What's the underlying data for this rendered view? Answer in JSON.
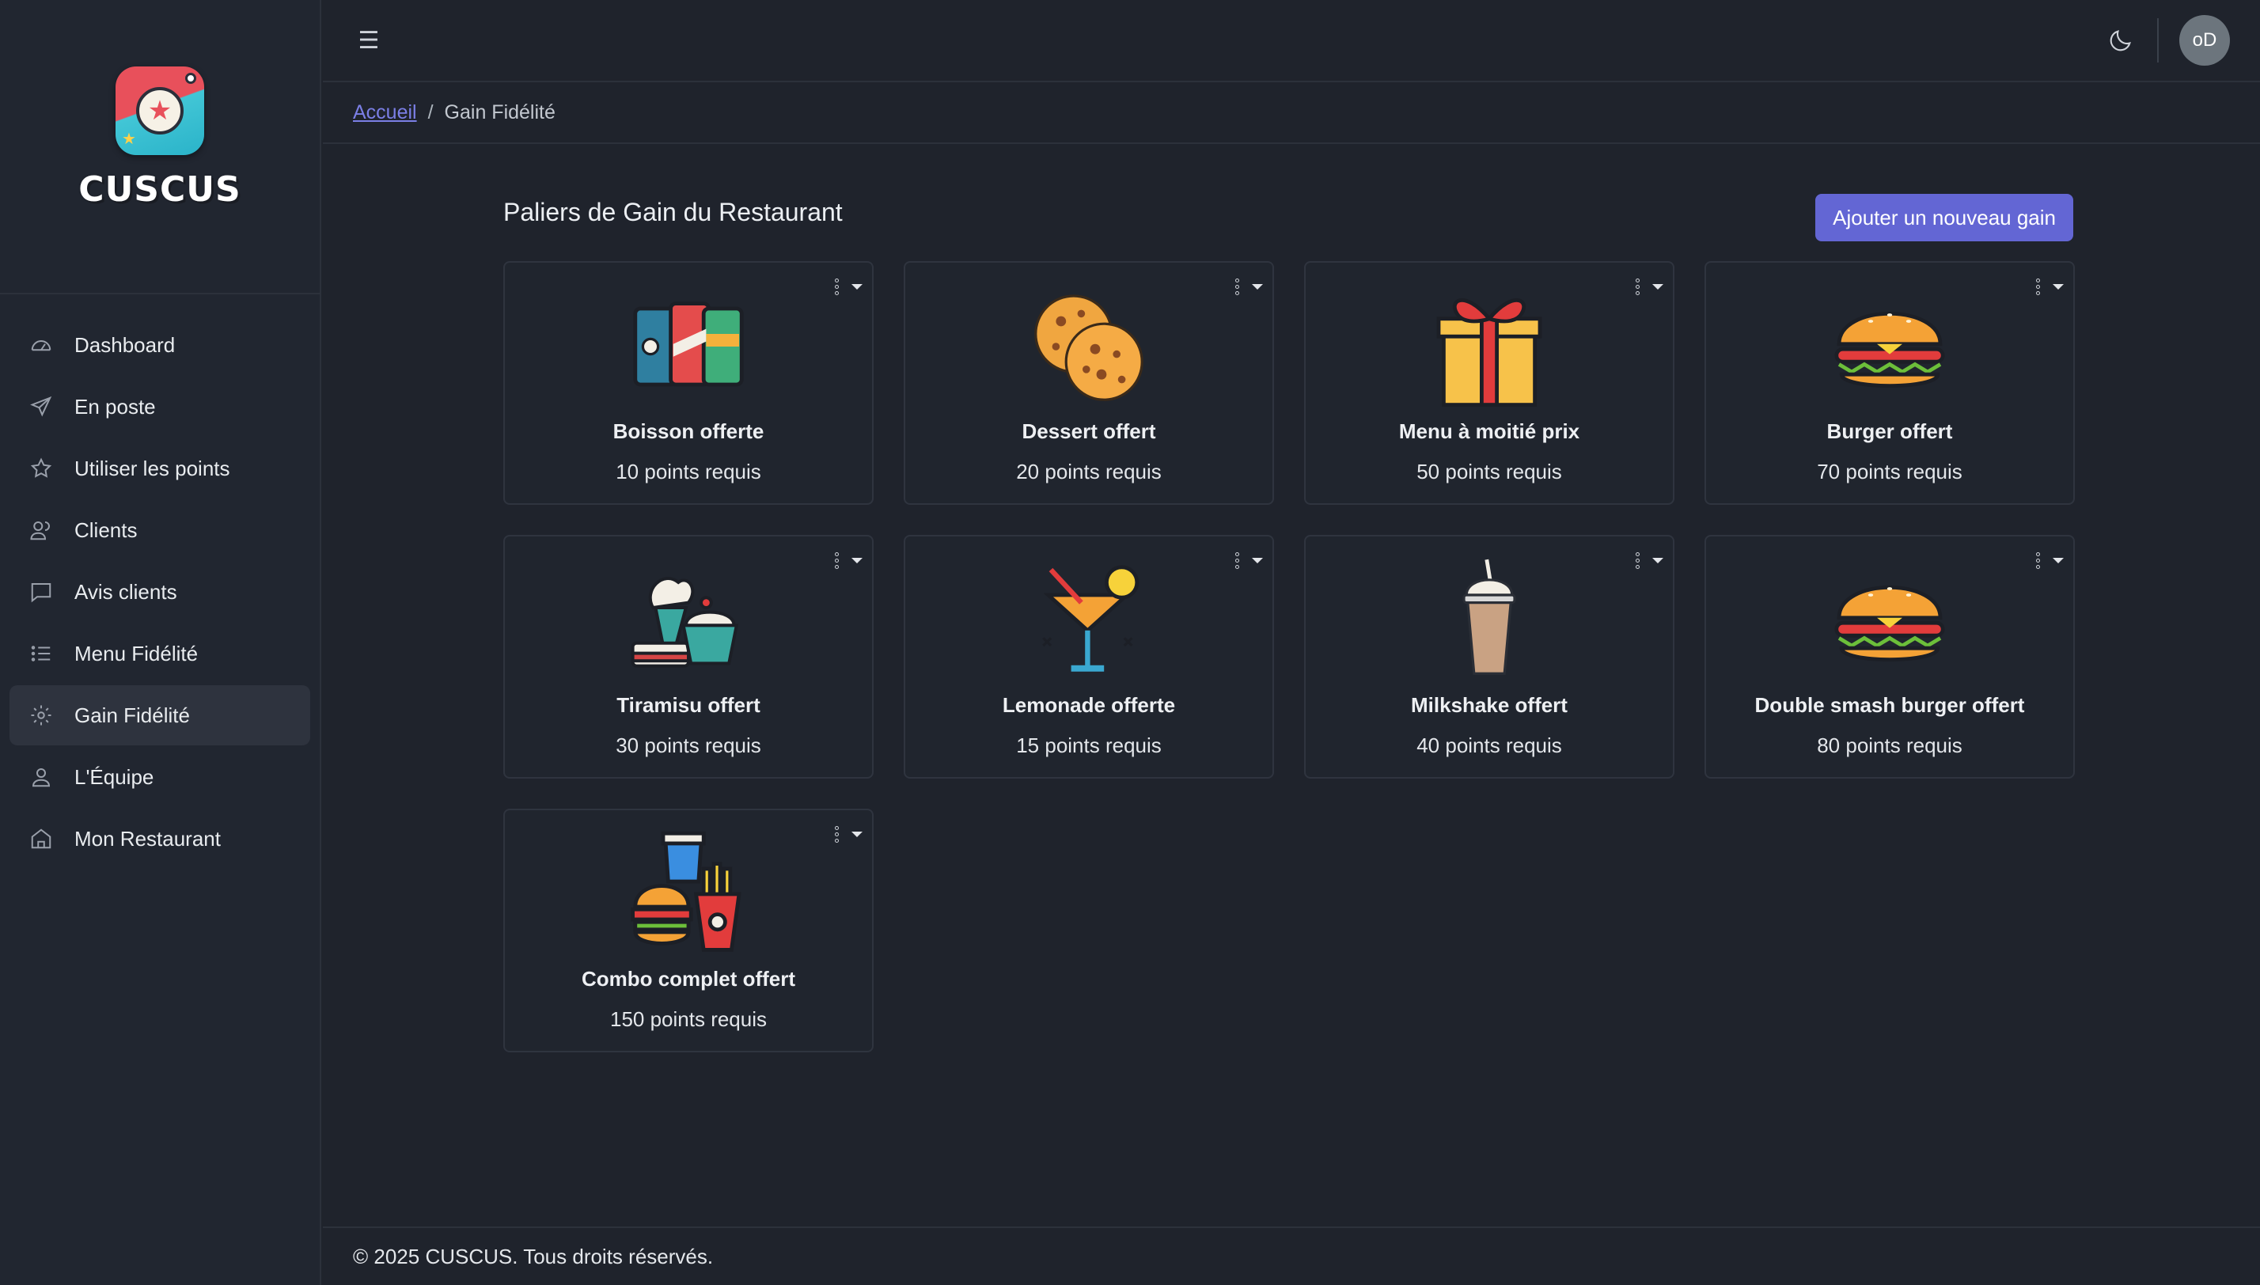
{
  "brand": {
    "name": "CUSCUS"
  },
  "sidebar": {
    "items": [
      {
        "label": "Dashboard",
        "icon": "gauge-icon"
      },
      {
        "label": "En poste",
        "icon": "send-icon"
      },
      {
        "label": "Utiliser les points",
        "icon": "star-icon"
      },
      {
        "label": "Clients",
        "icon": "users-icon"
      },
      {
        "label": "Avis clients",
        "icon": "chat-icon"
      },
      {
        "label": "Menu Fidélité",
        "icon": "list-icon"
      },
      {
        "label": "Gain Fidélité",
        "icon": "gear-icon",
        "active": true
      },
      {
        "label": "L'Équipe",
        "icon": "team-icon"
      },
      {
        "label": "Mon Restaurant",
        "icon": "store-icon"
      }
    ]
  },
  "topbar": {
    "avatar_initials": "oD",
    "menu_icon": "☰"
  },
  "breadcrumb": {
    "home": "Accueil",
    "separator": "/",
    "current": "Gain Fidélité"
  },
  "page": {
    "title": "Paliers de Gain du Restaurant",
    "add_button": "Ajouter un nouveau gain"
  },
  "rewards": [
    {
      "name": "Boisson offerte",
      "points": "10 points requis",
      "icon": "drinks-icon"
    },
    {
      "name": "Dessert offert",
      "points": "20 points requis",
      "icon": "cookies-icon"
    },
    {
      "name": "Menu à moitié prix",
      "points": "50 points requis",
      "icon": "gift-icon"
    },
    {
      "name": "Burger offert",
      "points": "70 points requis",
      "icon": "burger-icon"
    },
    {
      "name": "Tiramisu offert",
      "points": "30 points requis",
      "icon": "desserts-icon"
    },
    {
      "name": "Lemonade offerte",
      "points": "15 points requis",
      "icon": "cocktail-icon"
    },
    {
      "name": "Milkshake offert",
      "points": "40 points requis",
      "icon": "milkshake-icon"
    },
    {
      "name": "Double smash burger offert",
      "points": "80 points requis",
      "icon": "burger-icon"
    },
    {
      "name": "Combo complet offert",
      "points": "150 points requis",
      "icon": "combo-icon"
    }
  ],
  "footer": {
    "text": "© 2025 CUSCUS. Tous droits réservés."
  },
  "colors": {
    "accent": "#6366d4",
    "link": "#7b7fe6",
    "background": "#1f232c"
  }
}
